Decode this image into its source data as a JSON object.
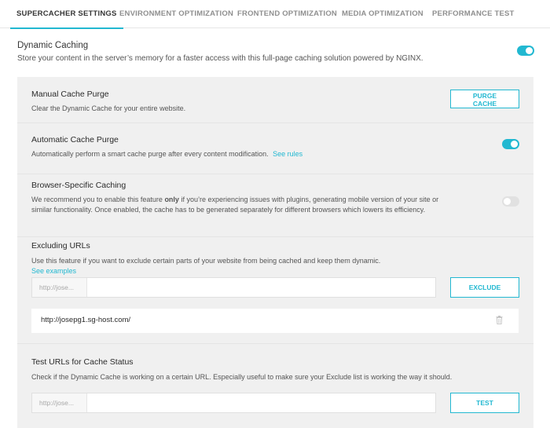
{
  "tabs": [
    {
      "label": "SUPERCACHER SETTINGS",
      "active": true
    },
    {
      "label": "ENVIRONMENT OPTIMIZATION",
      "active": false
    },
    {
      "label": "FRONTEND OPTIMIZATION",
      "active": false
    },
    {
      "label": "MEDIA OPTIMIZATION",
      "active": false
    },
    {
      "label": "PERFORMANCE TEST",
      "active": false
    }
  ],
  "dynamic_caching": {
    "title": "Dynamic Caching",
    "description": "Store your content in the server’s memory for a faster access with this full-page caching solution powered by NGINX.",
    "enabled": true
  },
  "manual_purge": {
    "title": "Manual Cache Purge",
    "description": "Clear the Dynamic Cache for your entire website.",
    "button_line1": "PURGE",
    "button_line2": "CACHE"
  },
  "auto_purge": {
    "title": "Automatic Cache Purge",
    "description": "Automatically perform a smart cache purge after every content modification.",
    "link": "See rules",
    "enabled": true
  },
  "browser_caching": {
    "title": "Browser-Specific Caching",
    "desc_before": "We recommend you to enable this feature ",
    "desc_bold": "only",
    "desc_after": " if you’re experiencing issues with plugins, generating mobile version of your site or similar functionality. Once enabled, the cache has to be generated separately for different browsers which lowers its efficiency.",
    "enabled": false
  },
  "excluding_urls": {
    "title": "Excluding URLs",
    "description": "Use this feature if you want to exclude certain parts of your website from being cached and keep them dynamic.",
    "link": "See examples",
    "prefix": "http://jose...",
    "value": "",
    "button": "EXCLUDE",
    "list": [
      "http://josepg1.sg-host.com/"
    ]
  },
  "test_urls": {
    "title": "Test URLs for Cache Status",
    "description": "Check if the Dynamic Cache is working on a certain URL. Especially useful to make sure your Exclude list is working the way it should.",
    "prefix": "http://jose...",
    "value": "",
    "button": "TEST"
  },
  "colors": {
    "accent": "#22b8d1",
    "panel_bg": "#f0f0f0",
    "toggle_off": "#e1e1e1"
  },
  "icons": {
    "trash": "trash-icon"
  }
}
